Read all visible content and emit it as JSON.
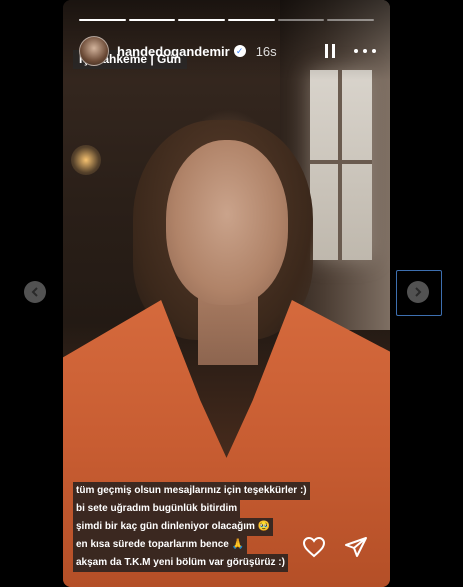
{
  "story": {
    "username": "handedogandemir",
    "time_ago": "16s",
    "verified_icon": "verified-badge-icon",
    "progress": {
      "segments": 6,
      "completed": 4
    },
    "top_sticker": "İç Mahkeme | Gün",
    "caption_lines": [
      "tüm geçmiş olsun mesajlarınız için teşekkürler :)",
      "bi sete uğradım bugünlük bitirdim",
      "şimdi bir kaç gün dinleniyor olacağım 🥹",
      "en kısa sürede toparlarım bence 🙏",
      "akşam da T.K.M yeni bölüm var görüşürüz :)"
    ]
  },
  "controls": {
    "pause_icon": "pause-icon",
    "more_icon": "more-options-icon",
    "like_icon": "heart-icon",
    "share_icon": "send-icon",
    "prev_icon": "chevron-left-icon",
    "next_icon": "chevron-right-icon"
  }
}
